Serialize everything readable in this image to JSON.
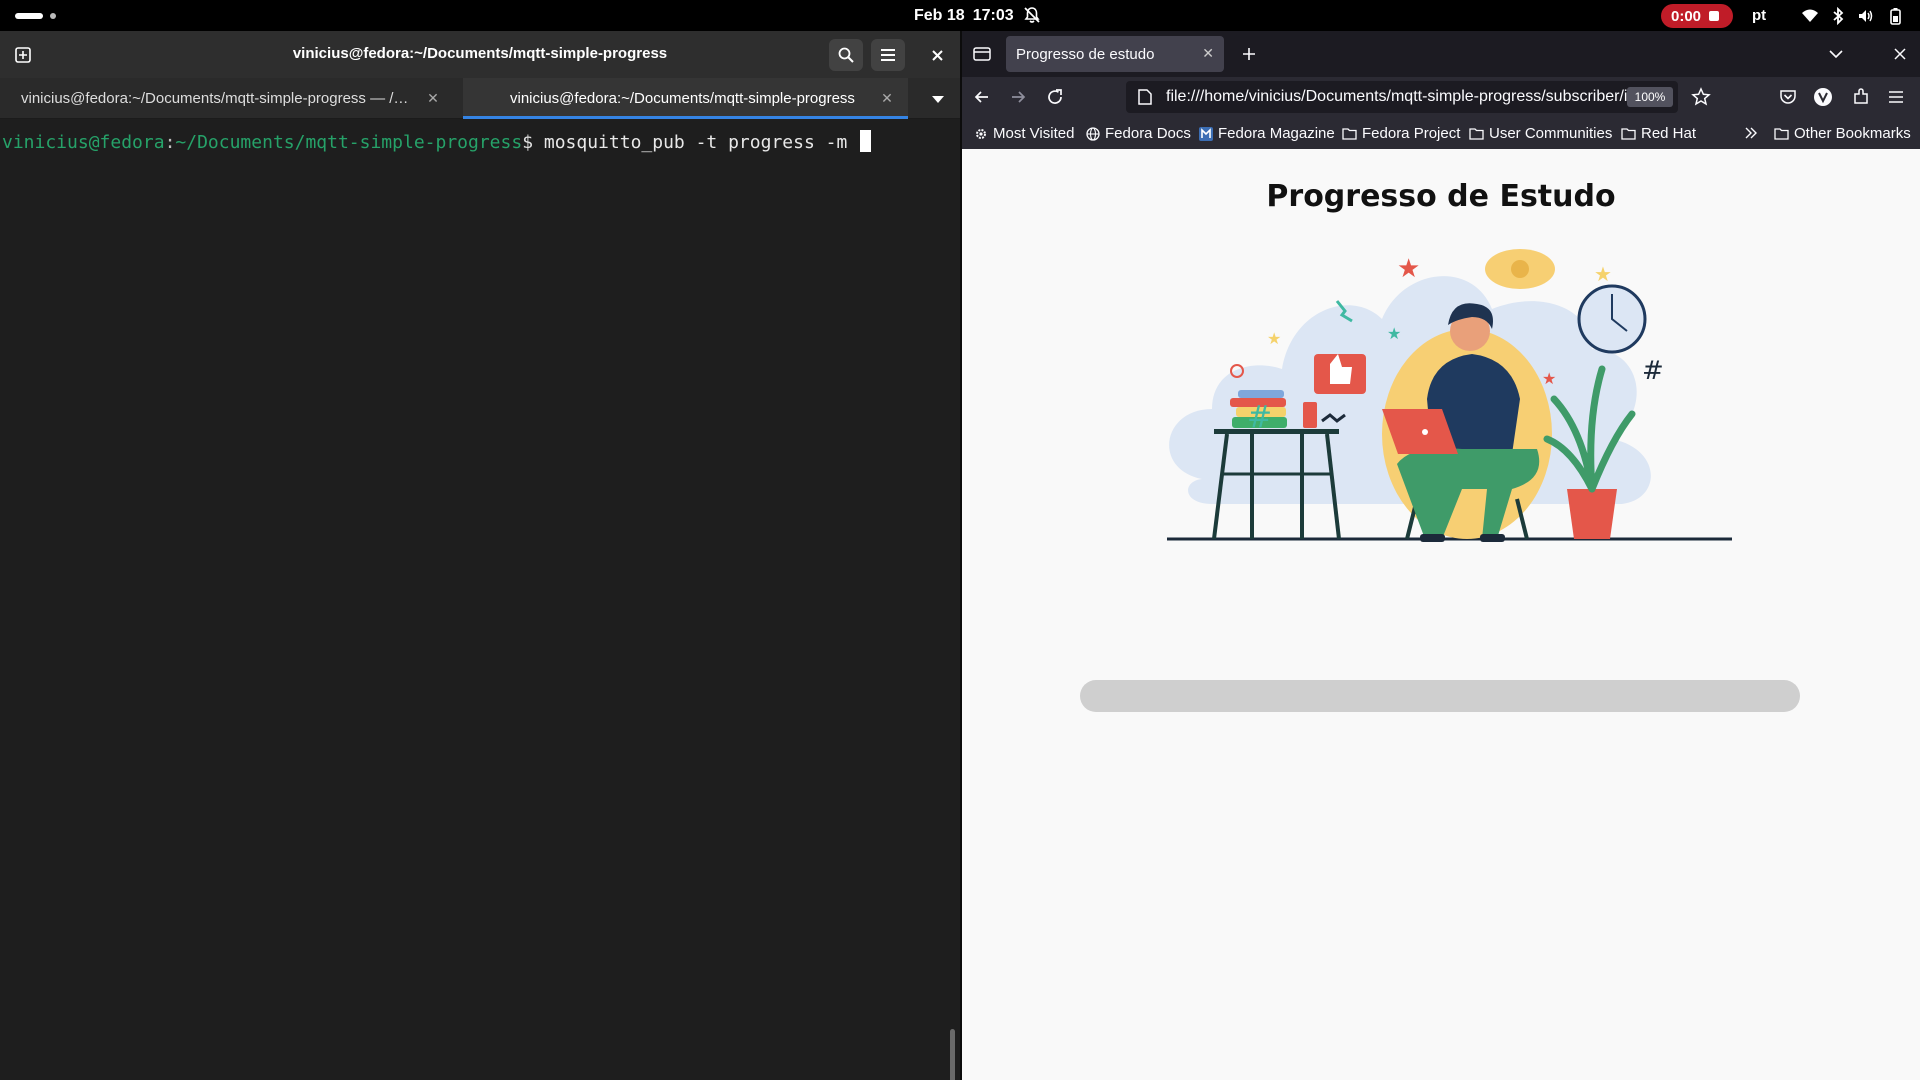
{
  "topbar": {
    "date": "Feb 18",
    "time": "17:03",
    "recording_time": "0:00",
    "keyboard_layout": "pt"
  },
  "terminal": {
    "window_title": "vinicius@fedora:~/Documents/mqtt-simple-progress",
    "tabs": [
      {
        "label": "vinicius@fedora:~/Documents/mqtt-simple-progress — /…",
        "active": false
      },
      {
        "label": "vinicius@fedora:~/Documents/mqtt-simple-progress",
        "active": true
      }
    ],
    "prompt": {
      "user_host": "vinicius@fedora",
      "colon": ":",
      "path": "~/Documents/mqtt-simple-progress",
      "dollar": "$",
      "command": " mosquitto_pub -t progress -m "
    }
  },
  "browser": {
    "tab_title": "Progresso de estudo",
    "url": "file:///home/vinicius/Documents/mqtt-simple-progress/subscriber/i",
    "zoom": "100%",
    "bookmarks": [
      "Most Visited",
      "Fedora Docs",
      "Fedora Magazine",
      "Fedora Project",
      "User Communities",
      "Red Hat"
    ],
    "other_bookmarks": "Other Bookmarks",
    "page": {
      "heading": "Progresso de Estudo",
      "progress_fraction": 0
    }
  },
  "colors": {
    "terminal_bg": "#1e1e1e",
    "prompt_green": "#26a269",
    "accent": "#3584e4",
    "record_red": "#c01c28",
    "progress_track": "#cfcfcf"
  }
}
